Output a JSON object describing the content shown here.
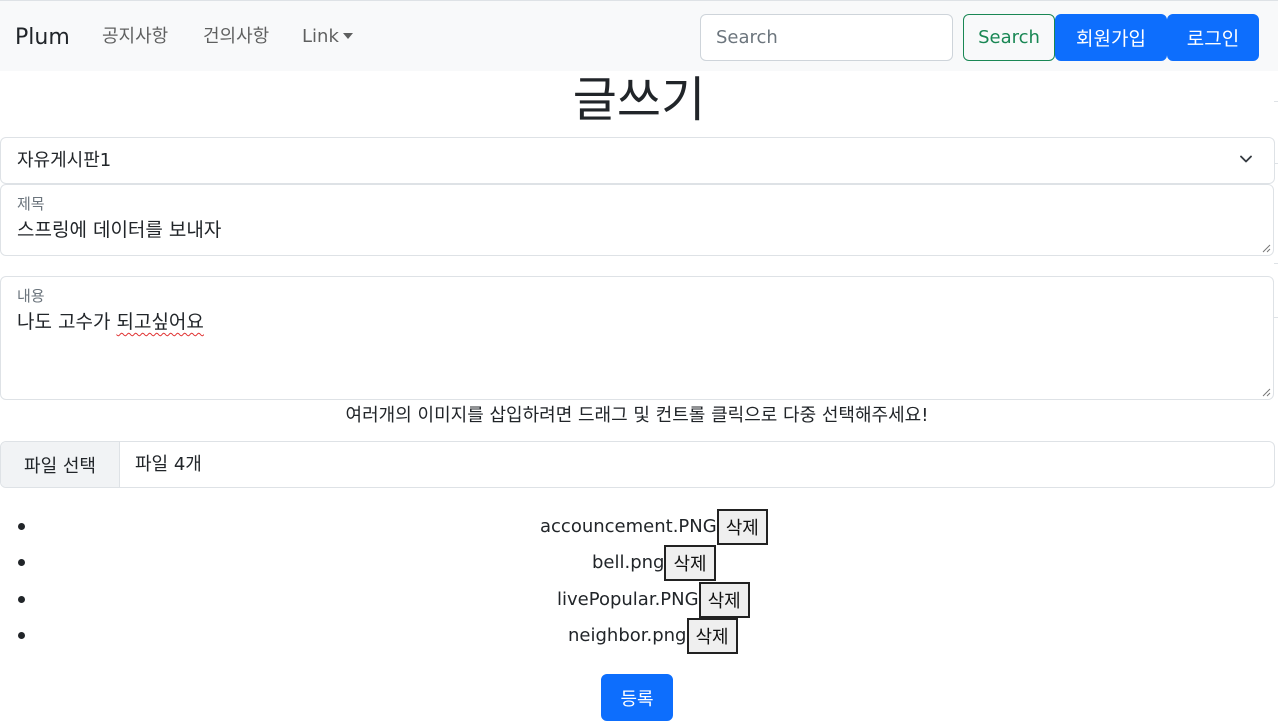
{
  "navbar": {
    "brand": "Plum",
    "links": [
      "공지사항",
      "건의사항"
    ],
    "dropdown_label": "Link",
    "search_placeholder": "Search",
    "search_button": "Search",
    "join_button": "회원가입",
    "login_button": "로그인"
  },
  "page": {
    "title": "글쓰기"
  },
  "board_select": {
    "selected": "자유게시판1"
  },
  "title_field": {
    "label": "제목",
    "value": "스프링에 데이터를 보내자"
  },
  "content_field": {
    "label": "내용",
    "value_plain": "나도 고수가 ",
    "value_misspelled": "되고싶어요"
  },
  "help_text": "여러개의 이미지를 삽입하려면 드래그 및 컨트롤 클릭으로 다중 선택해주세요!",
  "file_input": {
    "button": "파일 선택",
    "status": "파일 4개"
  },
  "files": [
    {
      "name": "accouncement.PNG",
      "delete_label": "삭제"
    },
    {
      "name": "bell.png",
      "delete_label": "삭제"
    },
    {
      "name": "livePopular.PNG",
      "delete_label": "삭제"
    },
    {
      "name": "neighbor.png",
      "delete_label": "삭제"
    }
  ],
  "submit_button": "등록",
  "colors": {
    "primary": "#0d6efd",
    "success": "#198754",
    "navbar_bg": "#f8f9fa"
  }
}
